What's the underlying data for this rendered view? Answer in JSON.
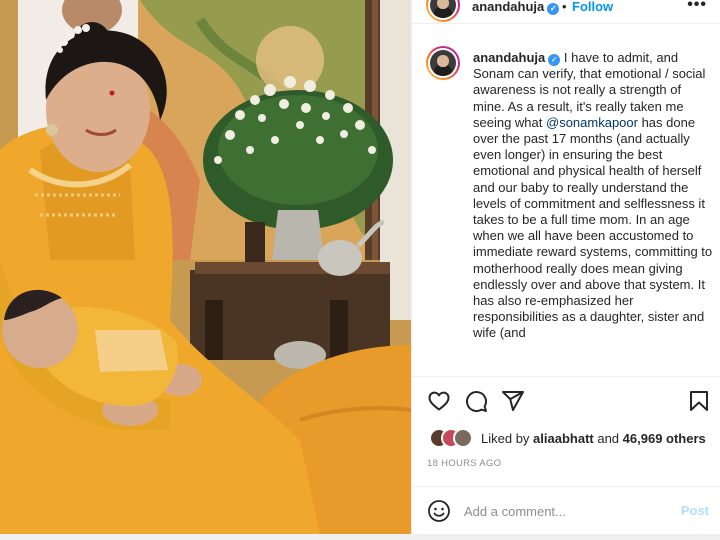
{
  "post": {
    "header": {
      "username": "anandahuja",
      "separator": "•",
      "follow_label": "Follow",
      "more_label": "•••"
    },
    "caption": {
      "username": "anandahuja",
      "text_before_mention": "I have to admit, and Sonam can verify, that emotional / social awareness is not really a strength of mine. As a result, it's really taken me seeing what ",
      "mention": "@sonamkapoor",
      "text_after_mention": " has done over the past 17 months (and actually even longer) in ensuring the best emotional and physical health of herself and our baby to really understand the levels of commitment and selflessness it takes to be a full time mom. In an age when we all have been accustomed to immediate reward systems, committing to motherhood really does mean giving endlessly over and above that system. It has also re-emphasized her responsibilities as a daughter, sister and wife (and"
    },
    "likes": {
      "prefix": "Liked by ",
      "liker": "aliaabhatt",
      "middle": " and ",
      "count": "46,969 others"
    },
    "timestamp": "18 HOURS AGO",
    "comment": {
      "placeholder": "Add a comment...",
      "post_label": "Post"
    }
  },
  "icons": [
    "heart-icon",
    "comment-icon",
    "share-icon",
    "bookmark-icon",
    "emoji-icon",
    "verified-badge-icon",
    "more-options-icon"
  ],
  "colors": {
    "follow": "#0095f6",
    "verified": "#3897f0",
    "mention": "#00376b",
    "post_disabled": "#b2dffc",
    "muted": "#8e8e8e"
  }
}
